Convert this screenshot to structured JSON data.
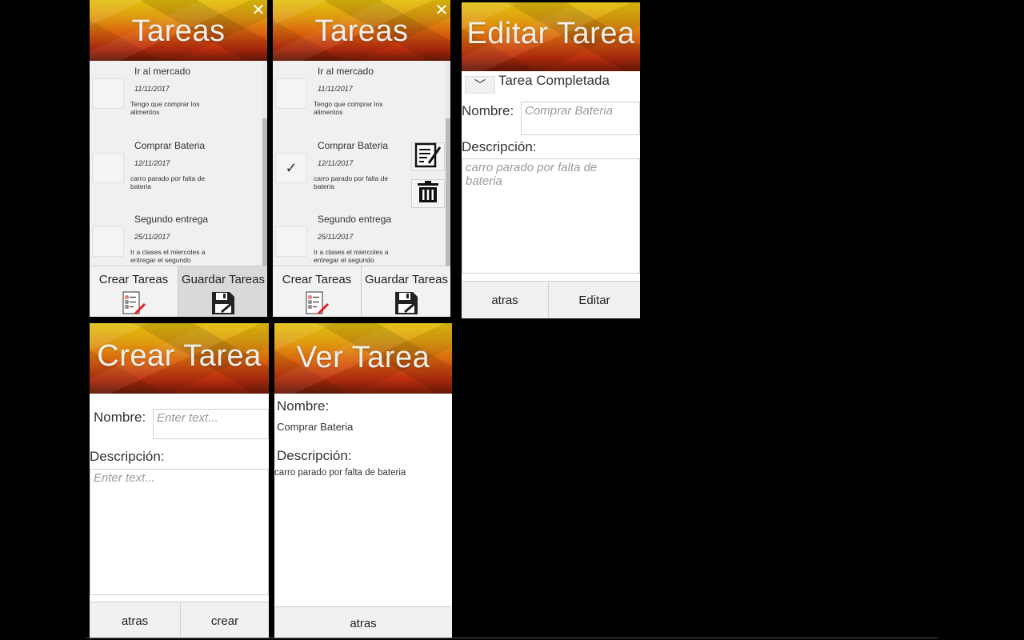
{
  "tareas_list": {
    "title": "Tareas",
    "close_glyph": "✕",
    "items": [
      {
        "name": "Ir al mercado",
        "date": "11/11/2017",
        "description": "Tengo que comprar los alimentos"
      },
      {
        "name": "Comprar Bateria",
        "date": "12/11/2017",
        "description": "carro parado por falta de bateria"
      },
      {
        "name": "Segundo entrega",
        "date": "25/11/2017",
        "description": "Ir a clases el miercoles a entregar el segundo"
      }
    ],
    "footer": {
      "create_label": "Crear Tareas",
      "save_label": "Guardar Tareas"
    }
  },
  "tareas_list_selected": {
    "title": "Tareas",
    "close_glyph": "✕",
    "items": [
      {
        "name": "Ir al mercado",
        "date": "11/11/2017",
        "description": "Tengo que comprar los alimentos",
        "checked": false
      },
      {
        "name": "Comprar Bateria",
        "date": "12/11/2017",
        "description": "carro parado por falta de bateria",
        "checked": true
      },
      {
        "name": "Segundo entrega",
        "date": "25/11/2017",
        "description": "Ir a clases el miercoles a entregar el segundo",
        "checked": false
      }
    ],
    "check_glyph": "✓",
    "footer": {
      "create_label": "Crear Tareas",
      "save_label": "Guardar Tareas"
    }
  },
  "editar": {
    "title": "Editar Tarea",
    "completed_label": "Tarea Completada",
    "check_glyph": "﹀",
    "nombre_label": "Nombre:",
    "nombre_placeholder": "Comprar Bateria",
    "descripcion_label": "Descripción:",
    "descripcion_placeholder": "carro parado por falta de bateria",
    "back_label": "atras",
    "edit_label": "Editar"
  },
  "crear": {
    "title": "Crear Tarea",
    "nombre_label": "Nombre:",
    "nombre_placeholder": "Enter text...",
    "descripcion_label": "Descripción:",
    "descripcion_placeholder": "Enter text...",
    "back_label": "atras",
    "create_label": "crear"
  },
  "ver": {
    "title": "Ver Tarea",
    "nombre_label": "Nombre:",
    "nombre_value": "Comprar Bateria",
    "descripcion_label": "Descripción:",
    "descripcion_value": "carro parado por falta de bateria",
    "back_label": "atras"
  },
  "icons": {
    "close": "close-icon",
    "check": "checkmark-icon",
    "create_list": "checklist-pencil-icon",
    "save": "floppy-disk-icon",
    "edit": "edit-document-icon",
    "delete": "trash-icon"
  },
  "colors": {
    "header_top": "#e2c00c",
    "header_mid": "#d9600e",
    "header_bottom": "#6d1a08",
    "background": "#000000"
  }
}
